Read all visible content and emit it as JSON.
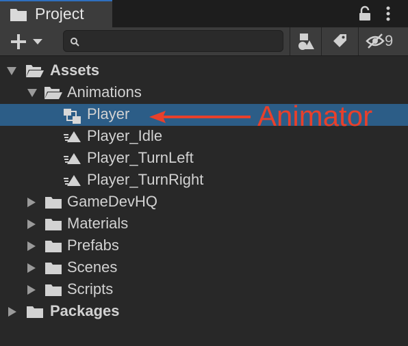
{
  "tab": {
    "title": "Project",
    "icon": "folder-icon"
  },
  "toolbar": {
    "create_icon": "plus-icon",
    "search_placeholder": "",
    "search_value": "",
    "hidden_count": "9"
  },
  "tree": [
    {
      "label": "Assets",
      "bold": true,
      "expanded": true,
      "icon": "folder-open-icon"
    },
    {
      "label": "Animations",
      "expanded": true,
      "icon": "folder-open-icon"
    },
    {
      "label": "Player",
      "icon": "animator-controller-icon",
      "selected": true
    },
    {
      "label": "Player_Idle",
      "icon": "animation-clip-icon"
    },
    {
      "label": "Player_TurnLeft",
      "icon": "animation-clip-icon"
    },
    {
      "label": "Player_TurnRight",
      "icon": "animation-clip-icon"
    },
    {
      "label": "GameDevHQ",
      "expanded": false,
      "icon": "folder-icon"
    },
    {
      "label": "Materials",
      "expanded": false,
      "icon": "folder-icon"
    },
    {
      "label": "Prefabs",
      "expanded": false,
      "icon": "folder-icon"
    },
    {
      "label": "Scenes",
      "expanded": false,
      "icon": "folder-icon"
    },
    {
      "label": "Scripts",
      "expanded": false,
      "icon": "folder-icon"
    },
    {
      "label": "Packages",
      "bold": true,
      "expanded": false,
      "icon": "folder-icon"
    }
  ],
  "annotation": {
    "text": "Animator",
    "color": "#e8402b"
  },
  "colors": {
    "selection": "#2c5d87",
    "panel": "#282828",
    "toolbar": "#3c3c3c"
  }
}
